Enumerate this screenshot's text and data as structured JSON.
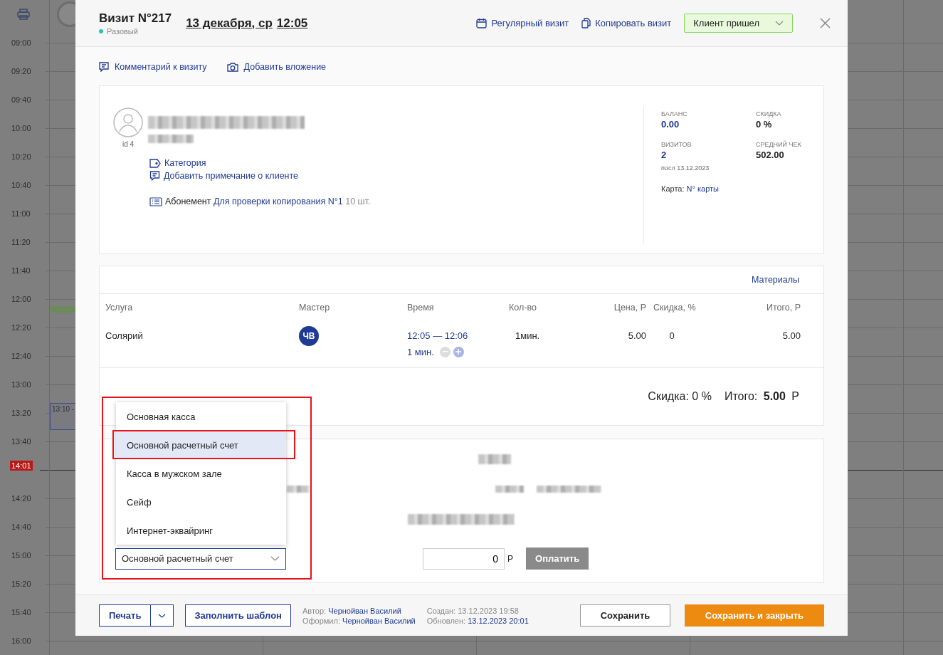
{
  "calendar": {
    "times": [
      "09:00",
      "09:20",
      "09:40",
      "10:00",
      "10:20",
      "10:40",
      "11:00",
      "11:20",
      "11:40",
      "12:00",
      "12:20",
      "12:40",
      "13:00",
      "13:20",
      "13:40",
      "14:20",
      "14:40",
      "15:00",
      "15:20",
      "15:40",
      "16:00"
    ],
    "now": [
      {
        "label": "14:01",
        "current": true
      }
    ],
    "event_label": "13:10 -"
  },
  "visit": {
    "title": "Визит N°217",
    "type": "Разовый",
    "date": "13 декабря, ср",
    "time": "12:05",
    "actions": [
      "Регулярный визит",
      "Копировать визит"
    ],
    "status": "Клиент пришел"
  },
  "links": [
    "Комментарий к визиту",
    "Добавить вложение"
  ],
  "client": {
    "id": "id 4",
    "links": [
      "Категория",
      "Добавить примечание о клиенте"
    ],
    "subscription": {
      "label": "Абонемент",
      "name": "Для проверки копирования N°1",
      "count": "10 шт."
    },
    "stats": [
      {
        "label": "БАЛАНС",
        "value": "0.00",
        "kind": "link"
      },
      {
        "label": "СКИДКА",
        "value": "0 %",
        "kind": "plain"
      },
      {
        "label": "ВИЗИТОВ",
        "value": "2",
        "kind": "link",
        "note": "посл 13.12.2023"
      },
      {
        "label": "СРЕДНИЙ ЧЕК",
        "value": "502.00",
        "kind": "plain"
      }
    ],
    "card_label": "Карта:",
    "card_value": "N° карты"
  },
  "services": {
    "materials": "Материалы",
    "columns": [
      "Услуга",
      "Мастер",
      "Время",
      "Кол-во",
      "Цена, Р",
      "Скидка, %",
      "Итого, Р"
    ],
    "rows": [
      {
        "service": "Солярий",
        "master": "ЧВ",
        "time": "12:05 — 12:06",
        "duration": "1 мин.",
        "qty": "1мин.",
        "price": "5.00",
        "discount": "0",
        "total": "5.00"
      }
    ],
    "summary": {
      "discount_label": "Скидка:",
      "discount": "0 %",
      "total_label": "Итого:",
      "total": "5.00",
      "currency": "Р"
    }
  },
  "payment": {
    "accounts": [
      {
        "label": "Основная касса",
        "selected": false
      },
      {
        "label": "Основной расчетный счет",
        "selected": true
      },
      {
        "label": "Касса в мужском зале",
        "selected": false
      },
      {
        "label": "Сейф",
        "selected": false
      },
      {
        "label": "Интернет-эквайринг",
        "selected": false
      }
    ],
    "select_value": "Основной расчетный счет",
    "amount": "0",
    "currency": "Р",
    "pay_button": "Оплатить"
  },
  "footer": {
    "print": "Печать",
    "template": "Заполнить шаблон",
    "author_label": "Автор:",
    "author": "Чернойван Василий",
    "issuer_label": "Оформил:",
    "issuer": "Чернойван Василий",
    "created_label": "Создан:",
    "created": "13.12.2023 19:58",
    "updated_label": "Обновлен:",
    "updated": "13.12.2023 20:01",
    "save": "Сохранить",
    "save_close": "Сохранить и закрыть"
  }
}
